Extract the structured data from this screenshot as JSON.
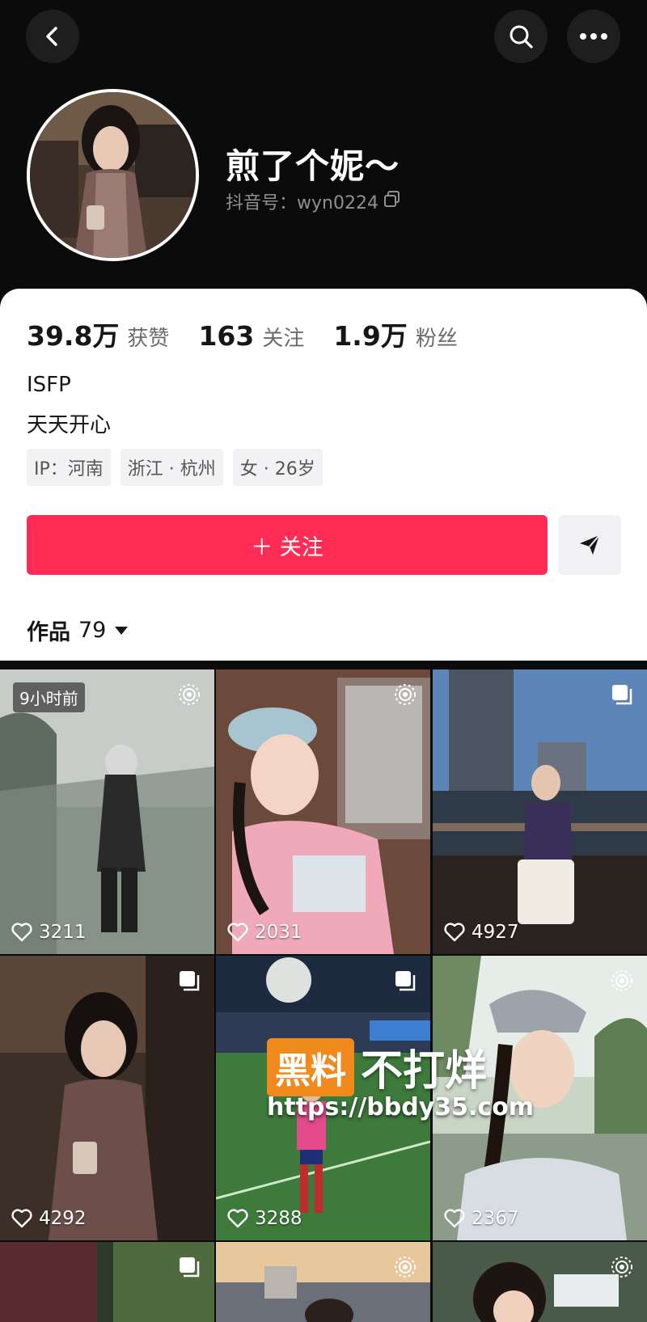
{
  "header": {
    "back_icon": "chevron-left-icon",
    "search_icon": "search-icon",
    "more_icon": "more-icon"
  },
  "profile": {
    "nickname": "煎了个妮～",
    "account_label": "抖音号：wyn0224",
    "copy_icon": "copy-icon"
  },
  "stats": [
    {
      "value": "39.8万",
      "label": "获赞"
    },
    {
      "value": "163",
      "label": "关注"
    },
    {
      "value": "1.9万",
      "label": "粉丝"
    }
  ],
  "bio": {
    "line1": "ISFP",
    "line2": "天天开心"
  },
  "tags": [
    "IP：河南",
    "浙江 · 杭州",
    "女 · 26岁"
  ],
  "actions": {
    "follow_label": "＋ 关注",
    "follow_color": "#fe2c55",
    "share_icon": "send-icon"
  },
  "works": {
    "label": "作品",
    "count": "79"
  },
  "grid": [
    {
      "likes": "3211",
      "badge": "9小时前",
      "type": "live"
    },
    {
      "likes": "2031",
      "type": "live"
    },
    {
      "likes": "4927",
      "type": "album"
    },
    {
      "likes": "4292",
      "type": "album"
    },
    {
      "likes": "3288",
      "type": "album"
    },
    {
      "likes": "2367",
      "type": "live"
    },
    {
      "likes": "",
      "type": "album"
    },
    {
      "likes": "",
      "type": "live"
    },
    {
      "likes": "",
      "type": "live"
    }
  ],
  "watermark": {
    "box_text": "黑料",
    "text": "不打烊",
    "url": "https://bbdy35.com"
  }
}
